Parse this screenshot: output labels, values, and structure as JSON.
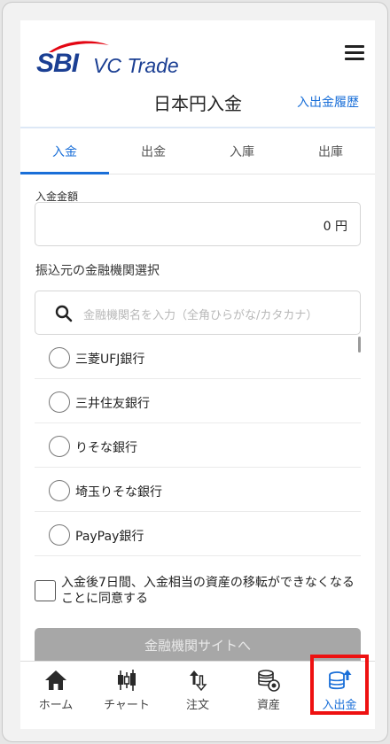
{
  "brand": {
    "logo_text": "SBI",
    "logo_sub": "VC Trade",
    "logo_color": "#1b3f93",
    "accent_color": "#e30613"
  },
  "header": {
    "title": "日本円入金",
    "history_link": "入出金履歴"
  },
  "tabs": [
    {
      "label": "入金",
      "active": true
    },
    {
      "label": "出金",
      "active": false
    },
    {
      "label": "入庫",
      "active": false
    },
    {
      "label": "出庫",
      "active": false
    }
  ],
  "amount": {
    "label": "入金金額",
    "value": "0 円"
  },
  "bank_select": {
    "label": "振込元の金融機関選択",
    "search_placeholder": "金融機関名を入力（全角ひらがな/カタカナ）",
    "banks": [
      {
        "name": "三菱UFJ銀行"
      },
      {
        "name": "三井住友銀行"
      },
      {
        "name": "りそな銀行"
      },
      {
        "name": "埼玉りそな銀行"
      },
      {
        "name": "PayPay銀行"
      }
    ]
  },
  "agreement": {
    "text": "入金後7日間、入金相当の資産の移転ができなくなることに同意する",
    "checked": false
  },
  "cta": {
    "label": "金融機関サイトへ",
    "enabled": false
  },
  "bottom_nav": [
    {
      "label": "ホーム",
      "icon": "home-icon"
    },
    {
      "label": "チャート",
      "icon": "candlestick-chart-icon"
    },
    {
      "label": "注文",
      "icon": "order-arrows-icon"
    },
    {
      "label": "資産",
      "icon": "coins-icon"
    },
    {
      "label": "入出金",
      "icon": "deposit-withdraw-icon",
      "active": true
    }
  ],
  "colors": {
    "primary": "#1a6fd8",
    "highlight": "#ee1111",
    "disabled_button": "#a7a7a7"
  }
}
